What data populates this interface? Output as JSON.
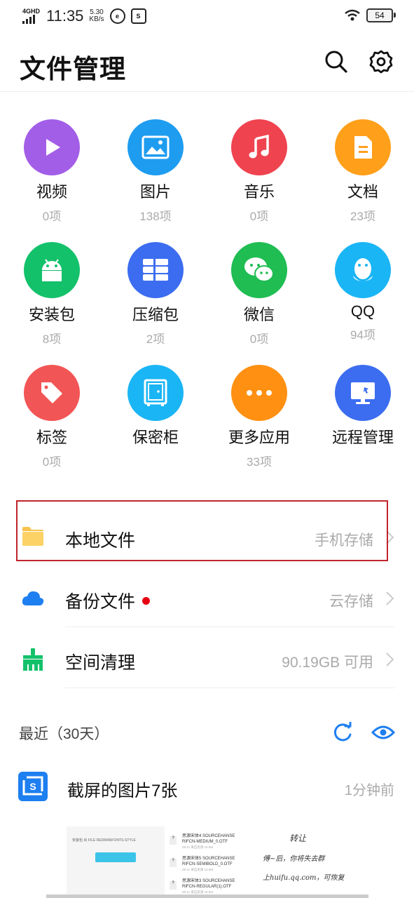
{
  "status_bar": {
    "network": "4GHD",
    "time": "11:35",
    "speed_value": "5.30",
    "speed_unit": "KB/s",
    "app_icon_1": "browser-icon",
    "app_icon_2": "screenshot-notify-icon",
    "battery": "54"
  },
  "header": {
    "title": "文件管理",
    "search_icon": "search-icon",
    "settings_icon": "gear-icon"
  },
  "categories": [
    {
      "name": "视频",
      "count": "0项",
      "icon": "play-icon",
      "color": "#a35ee8"
    },
    {
      "name": "图片",
      "count": "138项",
      "icon": "image-icon",
      "color": "#1e9cf0"
    },
    {
      "name": "音乐",
      "count": "0项",
      "icon": "music-note-icon",
      "color": "#ef4350"
    },
    {
      "name": "文档",
      "count": "23项",
      "icon": "document-icon",
      "color": "#ff9f1a"
    },
    {
      "name": "安装包",
      "count": "8项",
      "icon": "android-icon",
      "color": "#14c16b"
    },
    {
      "name": "压缩包",
      "count": "2项",
      "icon": "archive-icon",
      "color": "#3c6df0"
    },
    {
      "name": "微信",
      "count": "0项",
      "icon": "wechat-icon",
      "color": "#1fbd52"
    },
    {
      "name": "QQ",
      "count": "94项",
      "icon": "qq-penguin-icon",
      "color": "#1ab5f5"
    },
    {
      "name": "标签",
      "count": "0项",
      "icon": "tag-icon",
      "color": "#f25555"
    },
    {
      "name": "保密柜",
      "count": "",
      "icon": "safe-icon",
      "color": "#1ab5f5"
    },
    {
      "name": "更多应用",
      "count": "33项",
      "icon": "more-dots-icon",
      "color": "#ff9012"
    },
    {
      "name": "远程管理",
      "count": "",
      "icon": "monitor-icon",
      "color": "#3c6df0"
    }
  ],
  "list_rows": [
    {
      "label": "本地文件",
      "value": "手机存储",
      "icon": "folder-icon"
    },
    {
      "label": "备份文件",
      "value": "云存储",
      "icon": "cloud-icon"
    },
    {
      "label": "空间清理",
      "value": "90.19GB 可用",
      "icon": "broom-icon"
    }
  ],
  "recent": {
    "title": "最近（30天）",
    "refresh_icon": "refresh-icon",
    "eye_icon": "eye-icon",
    "item_label": "截屏的图片7张",
    "item_time": "1分钟前",
    "item_icon": "screenshot-icon"
  },
  "thumbnails": {
    "t1_line": "安装包 出 FILE REDMANFONTS-STYLE",
    "t2_rows": [
      {
        "name": "思源宋体4 SOURCEHANSE",
        "name2": "RIFCN-MEDIUM_0.OTF",
        "meta": "08-11  来自思源  15.6M"
      },
      {
        "name": "思源宋体5 SOURCEHANSE",
        "name2": "RIFCN-SEMIBOLD_0.OTF",
        "meta": "08-11  来自思源  15.8M"
      },
      {
        "name": "思源宋体3 SOURCEHANSE",
        "name2": "RIFCN-REGULAR(1).OTF",
        "meta": "08-11  来自思源  15.5M"
      }
    ],
    "t3_lines": [
      "转让",
      "傅~后，你将失去群",
      "上huifu.qq.com，可恢复"
    ]
  },
  "colors": {
    "accent_blue": "#1e7ff0",
    "highlight_border": "#c0242c",
    "red_dot": "#e60012",
    "broom_green": "#14c16b"
  }
}
